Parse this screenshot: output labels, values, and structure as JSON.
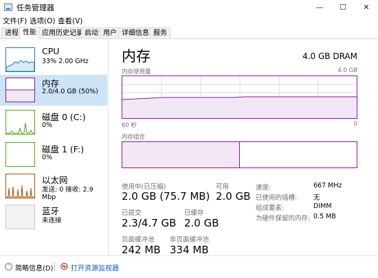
{
  "window": {
    "title": "任务管理器",
    "minimize": "—",
    "maximize": "☐",
    "close": "✕"
  },
  "menu": [
    "文件(F)",
    "选项(O)",
    "查看(V)"
  ],
  "tabs": [
    "进程",
    "性能",
    "应用历史记录",
    "启动",
    "用户",
    "详细信息",
    "服务"
  ],
  "active_tab": "性能",
  "sidebar": {
    "items": [
      {
        "title": "CPU",
        "sub": "33% 2.00 GHz",
        "color": "#117dbb"
      },
      {
        "title": "内存",
        "sub": "2.0/4.0 GB (50%)",
        "color": "#8b12ae"
      },
      {
        "title": "磁盘 0 (C:)",
        "sub": "0%",
        "color": "#4da60c"
      },
      {
        "title": "磁盘 1 (F:)",
        "sub": "0%",
        "color": "#4da60c"
      },
      {
        "title": "以太网",
        "sub": "发送: 0 接收: 2.9 Mbp",
        "color": "#a74f01"
      },
      {
        "title": "蓝牙",
        "sub": "未连接",
        "color": "#a74f01"
      }
    ]
  },
  "main": {
    "title": "内存",
    "total": "4.0 GB DRAM",
    "usage_label": "内存使用量",
    "usage_max": "4.0 GB",
    "axis_left": "60 秒",
    "axis_right": "0",
    "composition_label": "内存组合",
    "usage_fraction": 0.5,
    "stats": {
      "in_use_label": "使用中(已压缩)",
      "in_use_value": "2.0 GB (75.7 MB)",
      "available_label": "可用",
      "available_value": "2.0 GB",
      "committed_label": "已提交",
      "committed_value": "2.3/4.7 GB",
      "cached_label": "已缓存",
      "cached_value": "2.0 GB",
      "paged_label": "页面缓冲池",
      "paged_value": "242 MB",
      "nonpaged_label": "非页面缓冲池",
      "nonpaged_value": "334 MB"
    },
    "details": [
      {
        "label": "速度:",
        "value": "667 MHz"
      },
      {
        "label": "已使用的插槽:",
        "value": "无"
      },
      {
        "label": "组成要素:",
        "value": "DIMM"
      },
      {
        "label": "为硬件保留的内存:",
        "value": "0.5 MB"
      }
    ]
  },
  "footer": {
    "fewer_details": "简略信息(D)",
    "resource_monitor": "打开资源监视器"
  }
}
